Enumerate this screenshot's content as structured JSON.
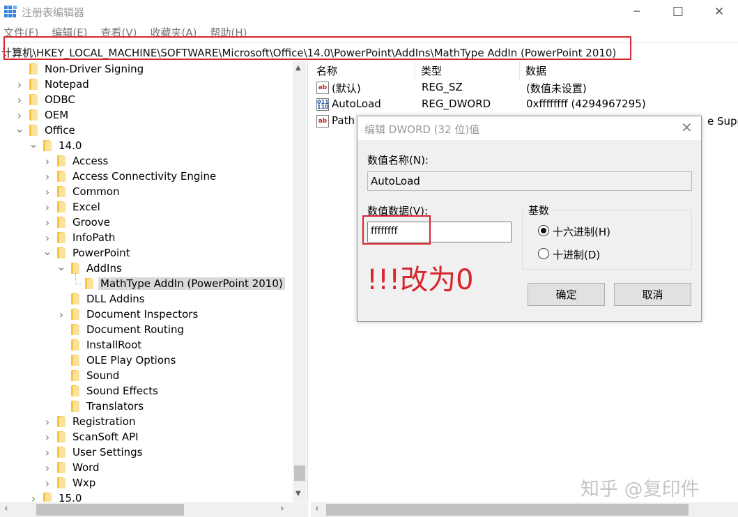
{
  "window": {
    "title": "注册表编辑器",
    "minimize_glyph": "─",
    "maximize_glyph": "☐",
    "close_glyph": "✕"
  },
  "menu": [
    "文件(F)",
    "编辑(E)",
    "查看(V)",
    "收藏夹(A)",
    "帮助(H)"
  ],
  "address": "计算机\\HKEY_LOCAL_MACHINE\\SOFTWARE\\Microsoft\\Office\\14.0\\PowerPoint\\AddIns\\MathType AddIn (PowerPoint 2010)",
  "tree": [
    {
      "label": "Non-Driver Signing",
      "depth": 1,
      "expander": "none"
    },
    {
      "label": "Notepad",
      "depth": 1,
      "expander": "collapsed"
    },
    {
      "label": "ODBC",
      "depth": 1,
      "expander": "collapsed"
    },
    {
      "label": "OEM",
      "depth": 1,
      "expander": "collapsed"
    },
    {
      "label": "Office",
      "depth": 1,
      "expander": "expanded"
    },
    {
      "label": "14.0",
      "depth": 2,
      "expander": "expanded"
    },
    {
      "label": "Access",
      "depth": 3,
      "expander": "collapsed"
    },
    {
      "label": "Access Connectivity Engine",
      "depth": 3,
      "expander": "collapsed"
    },
    {
      "label": "Common",
      "depth": 3,
      "expander": "collapsed"
    },
    {
      "label": "Excel",
      "depth": 3,
      "expander": "collapsed"
    },
    {
      "label": "Groove",
      "depth": 3,
      "expander": "collapsed"
    },
    {
      "label": "InfoPath",
      "depth": 3,
      "expander": "collapsed"
    },
    {
      "label": "PowerPoint",
      "depth": 3,
      "expander": "expanded"
    },
    {
      "label": "AddIns",
      "depth": 4,
      "expander": "expanded"
    },
    {
      "label": "MathType AddIn (PowerPoint 2010)",
      "depth": 5,
      "expander": "none",
      "selected": true
    },
    {
      "label": "DLL Addins",
      "depth": 4,
      "expander": "none"
    },
    {
      "label": "Document Inspectors",
      "depth": 4,
      "expander": "collapsed"
    },
    {
      "label": "Document Routing",
      "depth": 4,
      "expander": "none"
    },
    {
      "label": "InstallRoot",
      "depth": 4,
      "expander": "none"
    },
    {
      "label": "OLE Play Options",
      "depth": 4,
      "expander": "none"
    },
    {
      "label": "Sound",
      "depth": 4,
      "expander": "none"
    },
    {
      "label": "Sound Effects",
      "depth": 4,
      "expander": "none"
    },
    {
      "label": "Translators",
      "depth": 4,
      "expander": "none"
    },
    {
      "label": "Registration",
      "depth": 3,
      "expander": "collapsed"
    },
    {
      "label": "ScanSoft API",
      "depth": 3,
      "expander": "collapsed"
    },
    {
      "label": "User Settings",
      "depth": 3,
      "expander": "collapsed"
    },
    {
      "label": "Word",
      "depth": 3,
      "expander": "collapsed"
    },
    {
      "label": "Wxp",
      "depth": 3,
      "expander": "collapsed"
    },
    {
      "label": "15.0",
      "depth": 2,
      "expander": "collapsed"
    }
  ],
  "values_table": {
    "headers": [
      "名称",
      "类型",
      "数据"
    ],
    "rows": [
      {
        "icon": "string-value-icon",
        "icon_text": "ab",
        "name": "(默认)",
        "type": "REG_SZ",
        "data": "(数值未设置)"
      },
      {
        "icon": "binary-value-icon",
        "icon_text": "011\n110",
        "name": "AutoLoad",
        "type": "REG_DWORD",
        "data": "0xffffffff (4294967295)"
      },
      {
        "icon": "string-value-icon",
        "icon_text": "ab",
        "name": "Path",
        "type": "",
        "data": ""
      }
    ],
    "overflow_text": "e Suppo"
  },
  "dialog": {
    "title": "编辑 DWORD (32 位)值",
    "name_label": "数值名称(N):",
    "name_value": "AutoLoad",
    "data_label": "数值数据(V):",
    "data_value": "ffffffff",
    "base_label": "基数",
    "hex_label": "十六进制(H)",
    "dec_label": "十进制(D)",
    "selected_base": "hex",
    "ok_label": "确定",
    "cancel_label": "取消",
    "annotation": "!!!改为0",
    "annotation_color": "#d7262e"
  },
  "watermark": "知乎 @复印件"
}
